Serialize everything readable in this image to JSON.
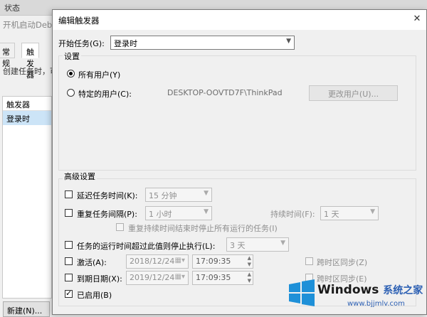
{
  "background": {
    "topstrip_text": "状态",
    "title": "开机启动Debe",
    "tabs": [
      "常规",
      "触发器"
    ],
    "description": "创建任务时，可",
    "list_header": "触发器",
    "list_row": "登录时",
    "new_button": "新建(N)..."
  },
  "dialog": {
    "title": "编辑触发器",
    "close_glyph": "✕",
    "start_task_label": "开始任务(G):",
    "start_task_value": "登录时",
    "settings_legend": "设置",
    "all_users_label": "所有用户(Y)",
    "specific_user_label": "特定的用户(C):",
    "computer_user": "DESKTOP-OOVTD7F\\ThinkPad",
    "change_user_button": "更改用户(U)...",
    "advanced_legend": "高级设置",
    "delay_label": "延迟任务时间(K):",
    "delay_value": "15 分钟",
    "repeat_label": "重复任务间隔(P):",
    "repeat_value": "1 小时",
    "duration_label": "持续时间(F):",
    "duration_value": "1 天",
    "stop_all_label": "重复持续时间结束时停止所有运行的任务(I)",
    "stop_if_longer_label": "任务的运行时间超过此值则停止执行(L):",
    "stop_if_longer_value": "3 天",
    "activate_label": "激活(A):",
    "activate_date": "2018/12/24",
    "activate_time": "17:09:35",
    "sync_tz_1": "跨时区同步(Z)",
    "expire_label": "到期日期(X):",
    "expire_date": "2019/12/24",
    "expire_time": "17:09:35",
    "sync_tz_2": "跨时区同步(E)",
    "enabled_label": "已启用(B)"
  },
  "watermark": {
    "brand": "Windows",
    "brand_cn": "系统之家",
    "url": "www.bjjmlv.com"
  },
  "icons": {
    "dropdown": "chevron-down-icon",
    "calendar": "calendar-icon",
    "spinner": "spin-arrows-icon",
    "close": "close-icon"
  }
}
